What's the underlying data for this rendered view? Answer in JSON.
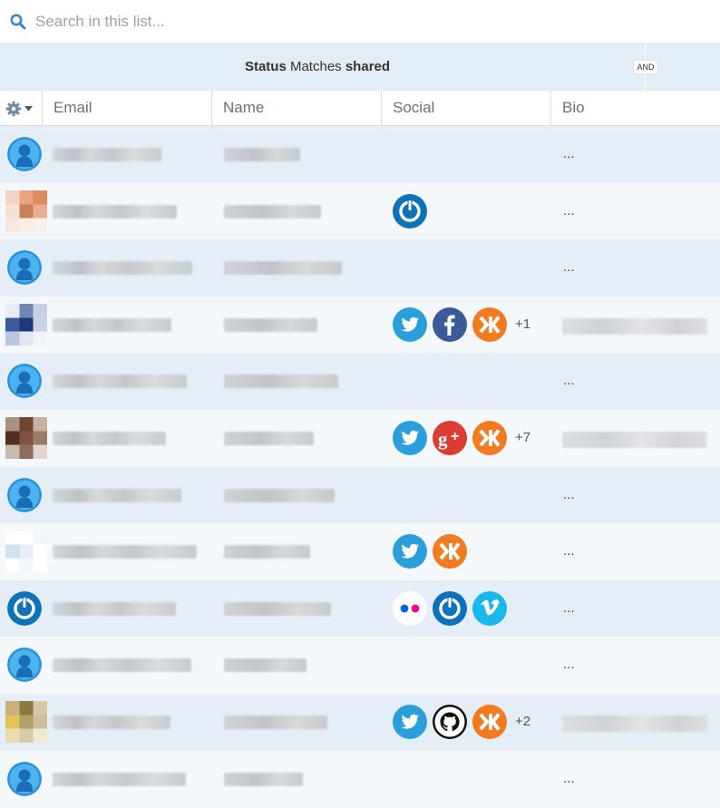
{
  "search": {
    "placeholder": "Search in this list..."
  },
  "filter": {
    "status_label": "Status",
    "matches_label": "Matches",
    "shared_label": "shared",
    "and_badge": "AND"
  },
  "columns": {
    "email": "Email",
    "name": "Name",
    "social": "Social",
    "bio": "Bio"
  },
  "colors": {
    "accent": "#3b9ddf",
    "row_odd": "#e5eef6",
    "row_even": "#f5f8fb"
  },
  "rows": [
    {
      "avatar": "default-user-icon",
      "social": [],
      "more": "",
      "bio": "..."
    },
    {
      "avatar": "photo",
      "social": [
        "power-icon"
      ],
      "more": "",
      "bio": "..."
    },
    {
      "avatar": "default-user-icon",
      "social": [],
      "more": "",
      "bio": "..."
    },
    {
      "avatar": "photo",
      "social": [
        "twitter-icon",
        "facebook-icon",
        "klout-icon"
      ],
      "more": "+1",
      "bio": ""
    },
    {
      "avatar": "default-user-icon",
      "social": [],
      "more": "",
      "bio": "..."
    },
    {
      "avatar": "photo",
      "social": [
        "twitter-icon",
        "google-plus-icon",
        "klout-icon"
      ],
      "more": "+7",
      "bio": ""
    },
    {
      "avatar": "default-user-icon",
      "social": [],
      "more": "",
      "bio": "..."
    },
    {
      "avatar": "photo",
      "social": [
        "twitter-icon",
        "klout-icon"
      ],
      "more": "",
      "bio": "..."
    },
    {
      "avatar": "power-icon",
      "social": [
        "flickr-icon",
        "power-icon",
        "vimeo-icon"
      ],
      "more": "",
      "bio": "..."
    },
    {
      "avatar": "default-user-icon",
      "social": [],
      "more": "",
      "bio": "..."
    },
    {
      "avatar": "photo",
      "social": [
        "twitter-icon",
        "github-icon",
        "klout-icon"
      ],
      "more": "+2",
      "bio": ""
    },
    {
      "avatar": "default-user-icon",
      "social": [],
      "more": "",
      "bio": "..."
    }
  ]
}
